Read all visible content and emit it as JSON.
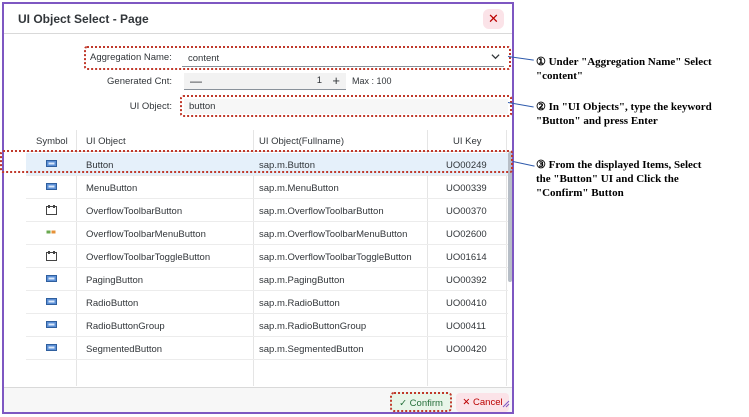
{
  "dialog": {
    "title": "UI Object Select - Page",
    "close_glyph": "✕"
  },
  "form": {
    "aggregation_label": "Aggregation Name:",
    "aggregation_value": "content",
    "generated_label": "Generated Cnt:",
    "generated_value": "1",
    "max_label": "Max : 100",
    "uiobject_label": "UI Object:",
    "uiobject_value": "button"
  },
  "table": {
    "headers": [
      "Symbol",
      "UI Object",
      "UI Object(Fullname)",
      "UI Key"
    ],
    "rows": [
      {
        "icon": "button-icon",
        "name": "Button",
        "fullname": "sap.m.Button",
        "key": "UO00249"
      },
      {
        "icon": "menu-button-icon",
        "name": "MenuButton",
        "fullname": "sap.m.MenuButton",
        "key": "UO00339"
      },
      {
        "icon": "overflow-toolbar-button-icon",
        "name": "OverflowToolbarButton",
        "fullname": "sap.m.OverflowToolbarButton",
        "key": "UO00370"
      },
      {
        "icon": "overflow-toolbar-menu-button-icon",
        "name": "OverflowToolbarMenuButton",
        "fullname": "sap.m.OverflowToolbarMenuButton",
        "key": "UO02600"
      },
      {
        "icon": "overflow-toolbar-toggle-button-icon",
        "name": "OverflowToolbarToggleButton",
        "fullname": "sap.m.OverflowToolbarToggleButton",
        "key": "UO01614"
      },
      {
        "icon": "paging-button-icon",
        "name": "PagingButton",
        "fullname": "sap.m.PagingButton",
        "key": "UO00392"
      },
      {
        "icon": "radio-button-icon",
        "name": "RadioButton",
        "fullname": "sap.m.RadioButton",
        "key": "UO00410"
      },
      {
        "icon": "radio-button-group-icon",
        "name": "RadioButtonGroup",
        "fullname": "sap.m.RadioButtonGroup",
        "key": "UO00411"
      },
      {
        "icon": "segmented-button-icon",
        "name": "SegmentedButton",
        "fullname": "sap.m.SegmentedButton",
        "key": "UO00420"
      }
    ]
  },
  "footer": {
    "confirm_label": "Confirm",
    "confirm_glyph": "✓",
    "cancel_label": "Cancel",
    "cancel_glyph": "✕"
  },
  "annotations": {
    "step1_line1": "① Under \"Aggregation Name\" Select",
    "step1_line2": "\"content\"",
    "step2_line1": "② In \"UI Objects\", type the keyword",
    "step2_line2": "\"Button\" and press Enter",
    "step3_line1": "③ From the displayed Items, Select",
    "step3_line2": "the \"Button\" UI and Click the",
    "step3_line3": "\"Confirm\" Button"
  },
  "colors": {
    "dialog_border": "#7e57c2",
    "highlight_dotted": "#c0392b",
    "selected_row": "#e5f0fa",
    "arrow": "#2e5aac"
  }
}
